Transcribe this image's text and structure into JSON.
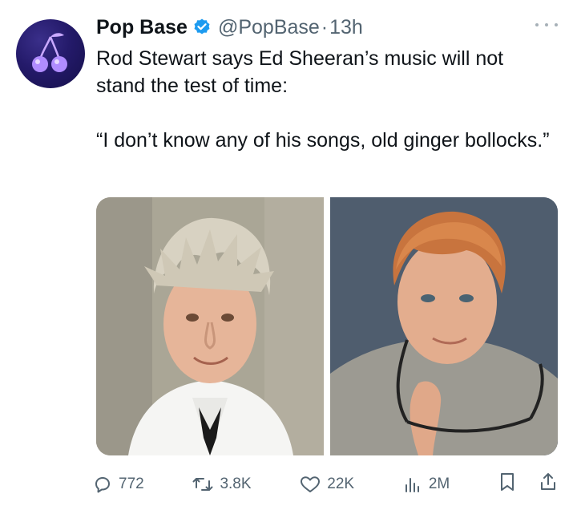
{
  "tweet": {
    "author_name": "Pop Base",
    "handle": "@PopBase",
    "time": "13h",
    "text_line1": "Rod Stewart says Ed Sheeran’s music will not stand the test of time:",
    "text_quote": "“I don’t know any of his songs, old ginger bollocks.”"
  },
  "actions": {
    "replies": "772",
    "reposts": "3.8K",
    "likes": "22K",
    "views": "2M"
  },
  "icons": {
    "verified": "verified-badge-icon",
    "more": "more-icon",
    "reply": "reply-icon",
    "repost": "repost-icon",
    "like": "like-icon",
    "views": "views-icon",
    "bookmark": "bookmark-icon",
    "share": "share-icon"
  },
  "colors": {
    "verified_blue": "#1d9bf0",
    "text_primary": "#0f1419",
    "text_secondary": "#536471"
  }
}
